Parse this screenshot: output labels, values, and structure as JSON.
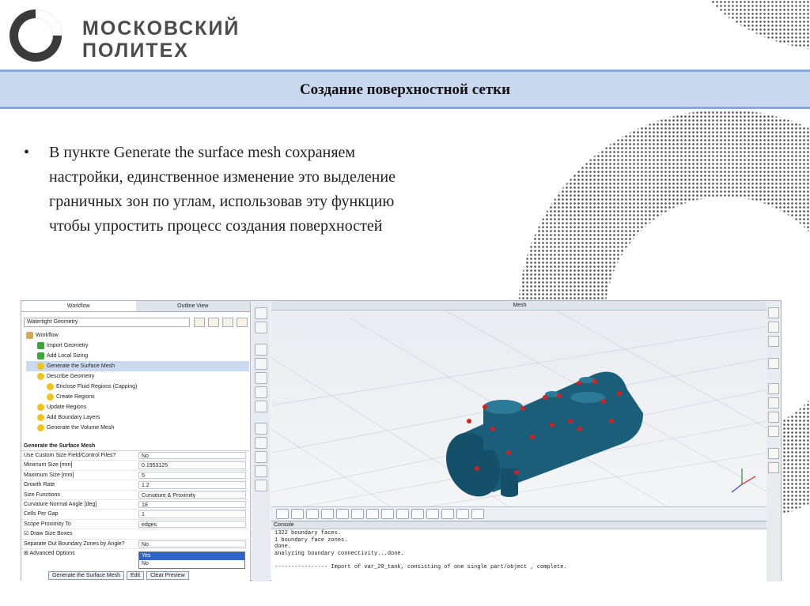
{
  "org": {
    "line1": "МОСКОВСКИЙ",
    "line2": "ПОЛИТЕХ"
  },
  "title": "Создание поверхностной сетки",
  "bullets": [
    "В пункте Generate the surface mesh сохраняем настройки, единственное изменение это выделение граничных зон по углам, использовав эту функцию чтобы упростить процесс создания поверхностей"
  ],
  "app": {
    "tabs": [
      "Workflow",
      "Outline View"
    ],
    "workflow_select": "Watertight Geometry",
    "tree": [
      {
        "label": "Workflow",
        "icon": "folder-icon"
      },
      {
        "label": "Import Geometry",
        "icon": "check-icon"
      },
      {
        "label": "Add Local Sizing",
        "icon": "check-icon"
      },
      {
        "label": "Generate the Surface Mesh",
        "icon": "warning-icon"
      },
      {
        "label": "Describe Geometry",
        "icon": "warning-icon"
      },
      {
        "label": "Enclose Fluid Regions (Capping)",
        "icon": "warning-icon"
      },
      {
        "label": "Create Regions",
        "icon": "warning-icon"
      },
      {
        "label": "Update Regions",
        "icon": "warning-icon"
      },
      {
        "label": "Add Boundary Layers",
        "icon": "warning-icon"
      },
      {
        "label": "Generate the Volume Mesh",
        "icon": "warning-icon"
      }
    ],
    "form_title": "Generate the Surface Mesh",
    "fields": [
      {
        "label": "Use Custom Size Field/Control Files?",
        "value": "No"
      },
      {
        "label": "Minimum Size [mm]",
        "value": "0.1953125"
      },
      {
        "label": "Maximum Size [mm]",
        "value": "5"
      },
      {
        "label": "Growth Rate",
        "value": "1.2"
      },
      {
        "label": "Size Functions",
        "value": "Curvature & Proximity"
      },
      {
        "label": "Curvature Normal Angle [deg]",
        "value": "18"
      },
      {
        "label": "Cells Per Gap",
        "value": "1"
      },
      {
        "label": "Scope Proximity To",
        "value": "edges"
      },
      {
        "label": "Draw Size Boxes",
        "value": ""
      },
      {
        "label": "Separate Out Boundary Zones by Angle?",
        "value": "No"
      }
    ],
    "dropdown_options": [
      "Yes",
      "No"
    ],
    "advanced_label": "Advanced Options",
    "buttons": [
      "Generate the Surface Mesh",
      "Edit",
      "Clear Preview"
    ],
    "viewport_title": "Mesh",
    "console_title": "Console",
    "console_lines": [
      "1322 boundary faces.",
      "1 boundary face zones.",
      "done.",
      "analyzing boundary connectivity...done.",
      "",
      "---------------- Import of var_20_tank, consisting of one single part/object , complete."
    ],
    "colors": {
      "model": "#1a5e7a",
      "markers": "#d62020"
    }
  }
}
